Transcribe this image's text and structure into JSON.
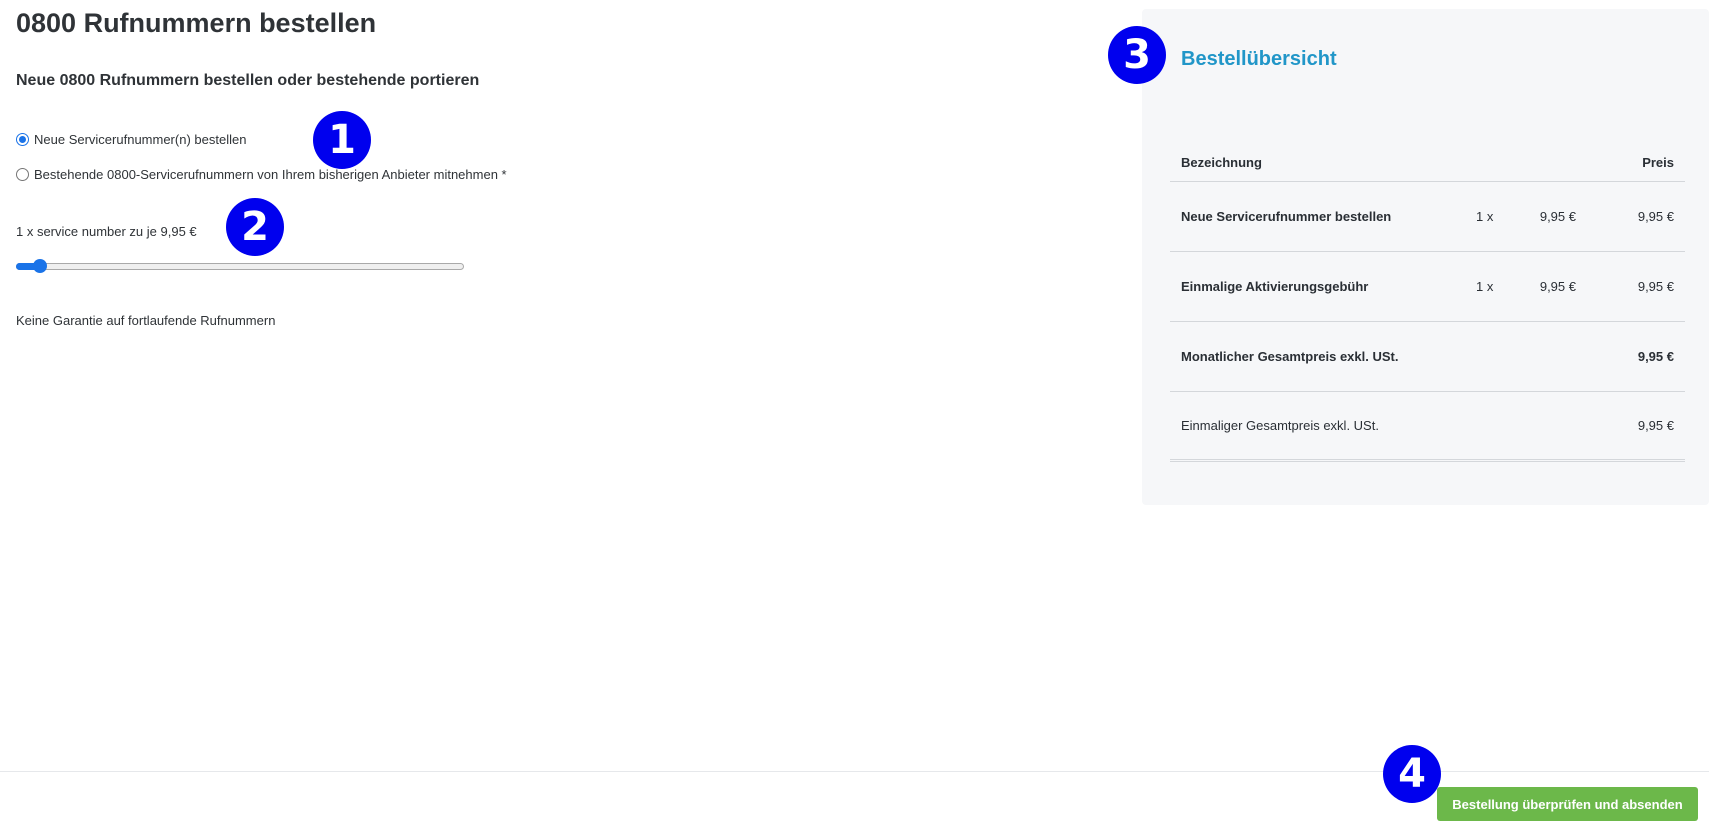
{
  "page": {
    "title": "0800 Rufnummern bestellen",
    "subtitle": "Neue 0800 Rufnummern bestellen oder bestehende portieren"
  },
  "options": [
    {
      "label": "Neue Servicerufnummer(n) bestellen",
      "checked": true
    },
    {
      "label": "Bestehende 0800-Servicerufnummern von Ihrem bisherigen Anbieter mitnehmen *",
      "checked": false
    }
  ],
  "quantity": {
    "label": "1 x service number zu je 9,95 €",
    "slider_fraction": 0.04
  },
  "note": "Keine Garantie auf fortlaufende Rufnummern",
  "summary": {
    "title": "Bestellübersicht",
    "headers": {
      "name": "Bezeichnung",
      "price": "Preis"
    },
    "rows": [
      {
        "name": "Neue Servicerufnummer bestellen",
        "qty": "1 x",
        "unit": "9,95 €",
        "price": "9,95 €"
      },
      {
        "name": "Einmalige Aktivierungsgebühr",
        "qty": "1 x",
        "unit": "9,95 €",
        "price": "9,95 €"
      },
      {
        "name": "Monatlicher Gesamtpreis exkl. USt.",
        "qty": "",
        "unit": "",
        "price": "9,95 €"
      },
      {
        "name": "Einmaliger Gesamtpreis exkl. USt.",
        "qty": "",
        "unit": "",
        "price": "9,95 €"
      }
    ]
  },
  "submit_label": "Bestellung überprüfen und absenden",
  "markers": [
    "1",
    "2",
    "3",
    "4"
  ],
  "colors": {
    "accent": "#1a73e8",
    "summary_title": "#2196c8",
    "submit": "#6cb84a",
    "marker": "#0000ee"
  }
}
